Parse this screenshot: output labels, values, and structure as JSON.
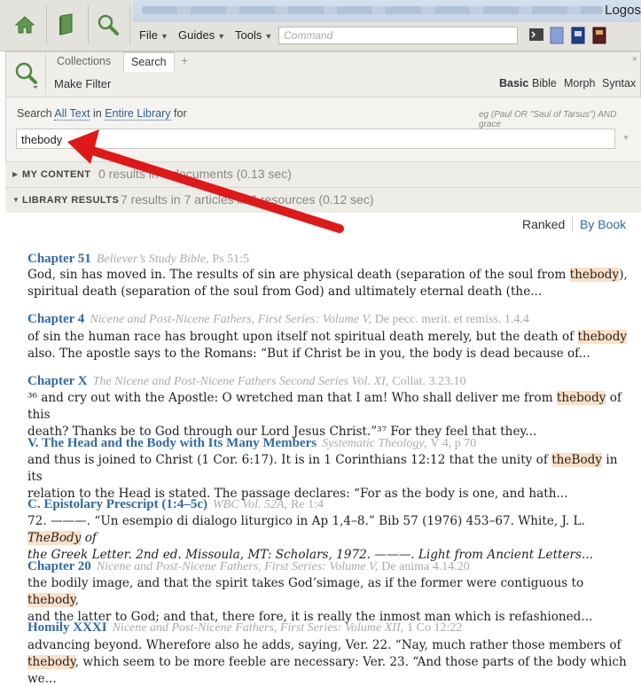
{
  "app": {
    "logo_text": "Logos"
  },
  "menu": [
    {
      "label": "File"
    },
    {
      "label": "Guides"
    },
    {
      "label": "Tools"
    }
  ],
  "command": {
    "placeholder": "Command"
  },
  "panel": {
    "tabs": [
      "Collections",
      "Search"
    ],
    "add_tab": "+",
    "close": "×",
    "make_filter": "Make Filter",
    "modes": [
      "Basic",
      "Bible",
      "Morph",
      "Syntax"
    ]
  },
  "search": {
    "prefix": "Search",
    "scope_text": "All Text",
    "in": "in",
    "scope_library": "Entire Library",
    "for": "for",
    "hint": "eg (Paul OR \"Saul of Tarsus\") AND grace",
    "query": "thebody"
  },
  "sections": {
    "my_content": {
      "label": "MY CONTENT",
      "stat": "0 results in 0 documents (0.13 sec)"
    },
    "library": {
      "label": "LIBRARY RESULTS",
      "stat": "7 results in 7 articles in 6 resources (0.12 sec)"
    }
  },
  "sort": {
    "ranked": "Ranked",
    "by_book": "By Book"
  },
  "results": [
    {
      "heading": "Chapter 51",
      "source": "Believer’s Study Bible,",
      "ref": "Ps 51:5",
      "line1": [
        "God, sin has moved in. The results of sin are physical death (separation of the soul from ",
        "thebody",
        "),"
      ],
      "line2": "spiritual death (separation of the soul from God) and ultimately eternal death (the..."
    },
    {
      "heading": "Chapter 4",
      "source": "Nicene and Post-Nicene Fathers, First Series: Volume V,",
      "ref": "De pecc. merit. et remiss. 1.4.4",
      "line1": [
        "of sin the human race has brought upon itself not spiritual death merely, but the death of ",
        "thebody",
        ""
      ],
      "line2": "also. The apostle says to the Romans: “But if Christ be in you, the body is dead because of..."
    },
    {
      "heading": "Chapter X",
      "source": "The Nicene and Post-Nicene Fathers Second Series Vol. XI,",
      "ref": "Collat. 3.23.10",
      "line1": [
        "³⁶ and cry out with the Apostle: O wretched man that I am! Who shall deliver me from ",
        "thebody",
        " of this"
      ],
      "line2": "death? Thanks be to God through our Lord Jesus Christ.”³⁷ For they feel that they..."
    },
    {
      "heading": "V. The Head and the Body with Its Many Members",
      "source": "Systematic Theology,",
      "ref": "V 4, p 70",
      "line1": [
        "and thus is joined to Christ (1 Cor. 6:17). It is in 1 Corinthians 12:12 that the unity of ",
        "theBody",
        " in its"
      ],
      "line2": "relation to the Head is stated. The passage declares: “For as the body is one, and hath..."
    },
    {
      "heading": "C. Epistolary Prescript (1:4–5c)",
      "source": "WBC Vol. 52A,",
      "ref": "Re 1:4",
      "line1": [
        "72. ———. “Un esempio di dialogo liturgico in Ap 1,4–8.” Bib 57 (1976) 453–67. White, J. L. ",
        "TheBody",
        " of"
      ],
      "line2": "the Greek Letter. 2nd ed. Missoula, MT: Scholars, 1972. ———. Light from Ancient Letters..."
    },
    {
      "heading": "Chapter 20",
      "source": "Nicene and Post-Nicene Fathers, First Series: Volume V,",
      "ref": "De anima 4.14.20",
      "line1": [
        "the bodily image, and that the spirit takes God’simage, as if the former were contiguous to ",
        "thebody",
        ","
      ],
      "line2": "and the latter to God; and that, there fore, it is really the inmost man which is refashioned..."
    },
    {
      "heading": "Homily XXXI",
      "source": "Nicene and Post-Nicene Fathers, First Series: Volume XII,",
      "ref": "1 Co 12:22",
      "line1": [
        "advancing beyond. Wherefore also he adds, saying, Ver. 22. “Nay, much rather those members of",
        "",
        ""
      ],
      "line2_parts": [
        "thebody",
        ", which seem to be more feeble are necessary: Ver. 23. “And those parts of the body which"
      ],
      "line3": "we..."
    }
  ]
}
